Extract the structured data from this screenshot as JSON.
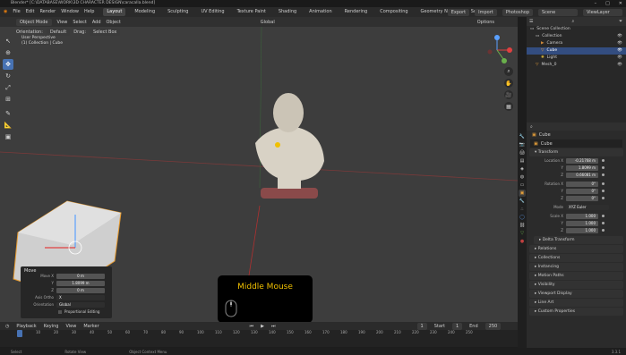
{
  "window": {
    "title": "Blender* [C:\\DATABASE\\WORK\\3D CHARACTER DESIGN\\caracalla.blend]"
  },
  "menubar": {
    "menus": [
      "File",
      "Edit",
      "Render",
      "Window",
      "Help"
    ],
    "workspaces": [
      "Layout",
      "Modeling",
      "Sculpting",
      "UV Editing",
      "Texture Paint",
      "Shading",
      "Animation",
      "Rendering",
      "Compositing",
      "Geometry Nodes",
      "Scripting"
    ],
    "right_buttons": [
      "Export",
      "Import",
      "Photoshop"
    ],
    "scene": "Scene",
    "view_layer": "ViewLayer"
  },
  "header3d": {
    "mode": "Object Mode",
    "menus": [
      "View",
      "Select",
      "Add",
      "Object"
    ],
    "orientation_label": "Orientation:",
    "orientation": "Default",
    "drag_label": "Drag:",
    "drag": "Select Box",
    "pivot": "Global",
    "options": "Options"
  },
  "viewport": {
    "view_name": "User Perspective",
    "collection_path": "(1) Collection | Cube"
  },
  "move_panel": {
    "title": "Move",
    "rows": [
      {
        "label": "Move X",
        "value": "0 m"
      },
      {
        "label": "Y",
        "value": "1.8099 m"
      },
      {
        "label": "Z",
        "value": "0 m"
      }
    ],
    "axis_ortho_label": "Axis Ortho",
    "axis_ortho_value": "X",
    "orientation_label": "Orientation",
    "orientation_value": "Global",
    "proportional_label": "Proportional Editing"
  },
  "overlay_text": "Middle Mouse",
  "timeline": {
    "menus": [
      "Playback",
      "Keying",
      "View",
      "Marker"
    ],
    "current_frame": "1",
    "start_label": "Start",
    "start": "1",
    "end_label": "End",
    "end": "250",
    "ticks": [
      "0",
      "10",
      "20",
      "30",
      "40",
      "50",
      "60",
      "70",
      "80",
      "90",
      "100",
      "110",
      "120",
      "130",
      "140",
      "150",
      "160",
      "170",
      "180",
      "190",
      "200",
      "210",
      "220",
      "230",
      "240",
      "250"
    ]
  },
  "status": {
    "items": [
      "Select",
      "Rotate View",
      "Object Context Menu"
    ],
    "version": "3.3.1"
  },
  "outliner": {
    "root": "Scene Collection",
    "items": [
      {
        "label": "Collection",
        "indent": 1,
        "selected": false
      },
      {
        "label": "Camera",
        "indent": 2,
        "selected": false
      },
      {
        "label": "Cube",
        "indent": 2,
        "selected": true
      },
      {
        "label": "Light",
        "indent": 2,
        "selected": false
      },
      {
        "label": "Mesh_0",
        "indent": 1,
        "selected": false
      }
    ]
  },
  "properties": {
    "object_name": "Cube",
    "object_field": "Cube",
    "transform_title": "Transform",
    "location": {
      "label": "Location X",
      "x": "-0.21768 m",
      "y": "1.8099 m",
      "z": "0.66081 m"
    },
    "rotation": {
      "label": "Rotation X",
      "x": "0°",
      "y": "0°",
      "z": "0°"
    },
    "mode_label": "Mode",
    "mode_value": "XYZ Euler",
    "scale": {
      "label": "Scale X",
      "x": "1.000",
      "y": "1.000",
      "z": "1.000"
    },
    "sections": [
      "Delta Transform",
      "Relations",
      "Collections",
      "Instancing",
      "Motion Paths",
      "Visibility",
      "Viewport Display",
      "Line Art",
      "Custom Properties"
    ]
  },
  "colors": {
    "accent": "#4772b3",
    "overlay_text": "#f0c000",
    "selected_row": "#334d80"
  }
}
